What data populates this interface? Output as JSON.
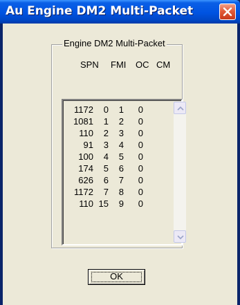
{
  "window": {
    "title": "Au Engine DM2 Multi-Packet"
  },
  "group": {
    "label": "Engine DM2 Multi-Packet"
  },
  "columns": [
    "SPN",
    "FMI",
    "OC",
    "CM"
  ],
  "rows": [
    [
      "1172",
      "0",
      "1",
      "0"
    ],
    [
      "1081",
      "1",
      "2",
      "0"
    ],
    [
      "110",
      "2",
      "3",
      "0"
    ],
    [
      "91",
      "3",
      "4",
      "0"
    ],
    [
      "100",
      "4",
      "5",
      "0"
    ],
    [
      "174",
      "5",
      "6",
      "0"
    ],
    [
      "626",
      "6",
      "7",
      "0"
    ],
    [
      "1172",
      "7",
      "8",
      "0"
    ],
    [
      "110",
      "15",
      "9",
      "0"
    ]
  ],
  "buttons": {
    "ok_label": "OK"
  },
  "icons": {
    "close": "close-icon",
    "scroll_up": "chevron-up-icon",
    "scroll_down": "chevron-down-icon"
  },
  "colors": {
    "titlebar": "#0053e1",
    "close_button": "#e25c3a",
    "dialog_face": "#ece9d8"
  }
}
